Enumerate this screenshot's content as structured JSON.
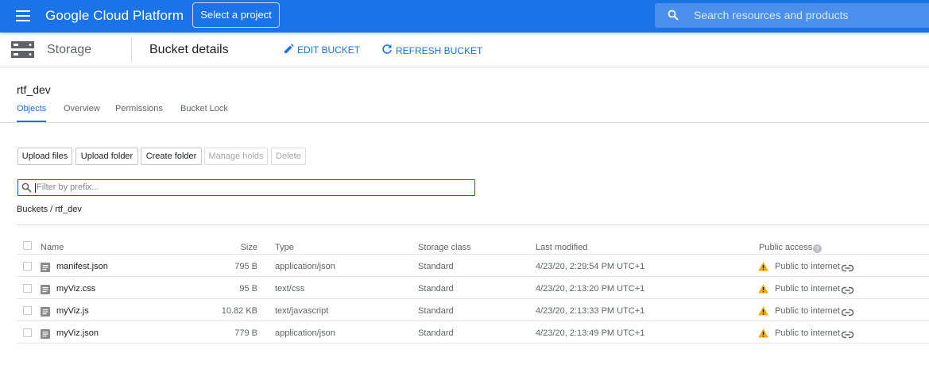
{
  "topbar": {
    "brand": "Google Cloud Platform",
    "project_button": "Select a project",
    "search_placeholder": "Search resources and products",
    "background_color": "#1a73e8"
  },
  "subheader": {
    "product": "Storage",
    "page_title": "Bucket details",
    "edit_label": "EDIT BUCKET",
    "refresh_label": "REFRESH BUCKET"
  },
  "bucket": {
    "name": "rtf_dev"
  },
  "tabs": [
    {
      "label": "Objects",
      "active": true
    },
    {
      "label": "Overview",
      "active": false
    },
    {
      "label": "Permissions",
      "active": false
    },
    {
      "label": "Bucket Lock",
      "active": false
    }
  ],
  "toolbar": {
    "upload_files": "Upload files",
    "upload_folder": "Upload folder",
    "create_folder": "Create folder",
    "manage_holds": "Manage holds",
    "delete": "Delete"
  },
  "filter": {
    "placeholder": "Filter by prefix..."
  },
  "breadcrumb": {
    "root": "Buckets",
    "separator": "/",
    "current": "rtf_dev"
  },
  "table": {
    "columns": {
      "name": "Name",
      "size": "Size",
      "type": "Type",
      "storage_class": "Storage class",
      "last_modified": "Last modified",
      "public_access": "Public access"
    },
    "rows": [
      {
        "name": "manifest.json",
        "size": "795 B",
        "type": "application/json",
        "storage_class": "Standard",
        "last_modified": "4/23/20, 2:29:54 PM UTC+1",
        "public_access": "Public to internet"
      },
      {
        "name": "myViz.css",
        "size": "95 B",
        "type": "text/css",
        "storage_class": "Standard",
        "last_modified": "4/23/20, 2:13:20 PM UTC+1",
        "public_access": "Public to internet"
      },
      {
        "name": "myViz.js",
        "size": "10.82 KB",
        "type": "text/javascript",
        "storage_class": "Standard",
        "last_modified": "4/23/20, 2:13:33 PM UTC+1",
        "public_access": "Public to internet"
      },
      {
        "name": "myViz.json",
        "size": "779 B",
        "type": "application/json",
        "storage_class": "Standard",
        "last_modified": "4/23/20, 2:13:49 PM UTC+1",
        "public_access": "Public to internet"
      }
    ]
  },
  "icons": {
    "menu": "hamburger-menu-icon",
    "search": "search-icon",
    "storage": "storage-icon",
    "edit": "pencil-icon",
    "refresh": "refresh-icon",
    "file": "file-icon",
    "warning": "warning-icon",
    "link": "link-icon",
    "help": "help-icon"
  },
  "colors": {
    "accent": "#1a73e8",
    "warning": "#f9ab00"
  }
}
